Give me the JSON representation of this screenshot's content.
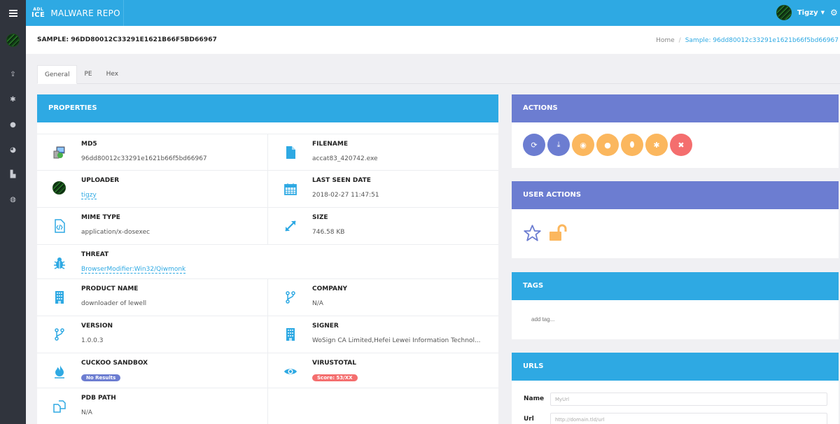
{
  "app": {
    "logo_top": "ADL",
    "logo_bottom": "ICE",
    "title": "MALWARE REPO"
  },
  "user": {
    "name": "Tigzy"
  },
  "sidebar": {
    "items": [
      {
        "icon": "upload-icon",
        "glyph": "⇪"
      },
      {
        "icon": "bug-icon",
        "glyph": "✱"
      },
      {
        "icon": "android-icon",
        "glyph": "●"
      },
      {
        "icon": "pie-chart-icon",
        "glyph": "◕"
      },
      {
        "icon": "bar-chart-icon",
        "glyph": "▙"
      },
      {
        "icon": "github-icon",
        "glyph": "◍"
      }
    ]
  },
  "header": {
    "title": "SAMPLE: 96DD80012C33291E1621B66F5BD66967",
    "breadcrumb": {
      "home": "Home",
      "separator": "/",
      "current": "Sample: 96dd80012c33291e1621b66f5bd66967"
    }
  },
  "tabs": [
    {
      "label": "General",
      "active": true
    },
    {
      "label": "PE",
      "active": false
    },
    {
      "label": "Hex",
      "active": false
    }
  ],
  "properties": {
    "title": "PROPERTIES",
    "md5": {
      "label": "MD5",
      "value": "96dd80012c33291e1621b66f5bd66967"
    },
    "filename": {
      "label": "FILENAME",
      "value": "accat83_420742.exe"
    },
    "uploader": {
      "label": "UPLOADER",
      "value": "tigzy"
    },
    "last_seen": {
      "label": "LAST SEEN DATE",
      "value": "2018-02-27 11:47:51"
    },
    "mime": {
      "label": "MIME TYPE",
      "value": "application/x-dosexec"
    },
    "size": {
      "label": "SIZE",
      "value": "746.58 KB"
    },
    "threat": {
      "label": "THREAT",
      "value": "BrowserModifier:Win32/Qiwmonk"
    },
    "product": {
      "label": "PRODUCT NAME",
      "value": "downloader of lewell"
    },
    "company": {
      "label": "COMPANY",
      "value": "N/A"
    },
    "version": {
      "label": "VERSION",
      "value": "1.0.0.3"
    },
    "signer": {
      "label": "SIGNER",
      "value": "WoSign CA Limited,Hefei Lewei Information Technol..."
    },
    "cuckoo": {
      "label": "CUCKOO SANDBOX",
      "badge": "No Results",
      "badge_color": "#6c7dd1"
    },
    "virustotal": {
      "label": "VIRUSTOTAL",
      "badge": "Score: 53/XX",
      "badge_color": "#f46e6e"
    },
    "pdb": {
      "label": "PDB PATH",
      "value": "N/A"
    }
  },
  "actions": {
    "title": "ACTIONS",
    "buttons": [
      {
        "name": "refresh",
        "glyph": "⟳",
        "color": "#6c7dd1"
      },
      {
        "name": "download",
        "glyph": "⤓",
        "color": "#6c7dd1"
      },
      {
        "name": "view",
        "glyph": "◉",
        "color": "#fbb75e"
      },
      {
        "name": "comment",
        "glyph": "●",
        "color": "#fbb75e"
      },
      {
        "name": "sandbox",
        "glyph": "⬮",
        "color": "#fbb75e"
      },
      {
        "name": "bug",
        "glyph": "✱",
        "color": "#fbb75e"
      },
      {
        "name": "delete",
        "glyph": "✖",
        "color": "#f46e6e"
      }
    ]
  },
  "user_actions": {
    "title": "USER ACTIONS",
    "star_color": "#6c7dd1",
    "lock_color": "#fbb75e"
  },
  "tags": {
    "title": "TAGS",
    "placeholder": "add tag..."
  },
  "urls": {
    "title": "URLS",
    "name_label": "Name",
    "name_placeholder": "MyUrl",
    "url_label": "Url",
    "url_placeholder": "http://domain.tld/url"
  },
  "colors": {
    "primary": "#2ea9e3",
    "secondary": "#6c7dd1",
    "warning": "#fbb75e",
    "danger": "#f46e6e",
    "sidebar": "#30343d"
  }
}
